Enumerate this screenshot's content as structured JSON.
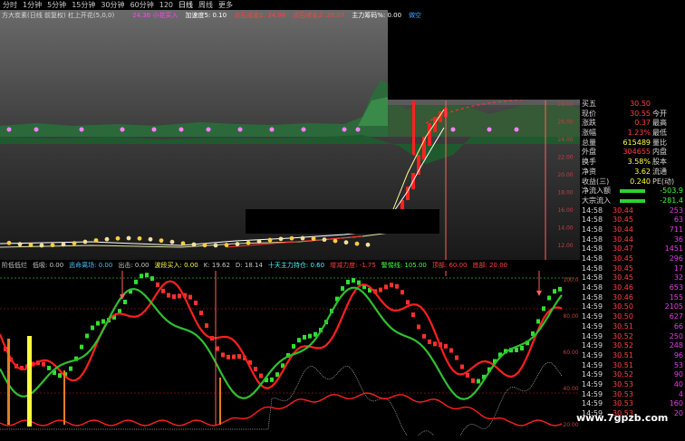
{
  "periods": [
    "分时",
    "1分钟",
    "5分钟",
    "15分钟",
    "30分钟",
    "60分钟",
    "120",
    "日线",
    "周线",
    "更多"
  ],
  "active_period": "日线",
  "chart_title": "方大炭素(日线 前复权) 杠上开花(5,0,0)",
  "main_indicators": [
    {
      "label": "24.36 小花买入",
      "color": "#ff40ff"
    },
    {
      "label": "加速度5: 0.10",
      "color": "#ffffff"
    },
    {
      "label": "点石成金1: 34.96",
      "color": "#ff4040"
    },
    {
      "label": "点石成金2: 20.07",
      "color": "#ff4040"
    },
    {
      "label": "主力筹码%: 0.00",
      "color": "#ffffff"
    },
    {
      "label": "做空",
      "color": "#40a0ff"
    }
  ],
  "price_axis": [
    "28.00",
    "26.00",
    "24.00",
    "22.00",
    "20.00",
    "18.00",
    "16.00",
    "14.00",
    "12.00",
    "10.00"
  ],
  "indicator_header": [
    {
      "label": "阶低低烂",
      "color": "#c8c8c8"
    },
    {
      "label": "低吸: 0.00",
      "color": "#c8c8c8"
    },
    {
      "label": "逃命离场: 0.00",
      "color": "#40c0ff"
    },
    {
      "label": "出击: 0.00",
      "color": "#c8c8c8"
    },
    {
      "label": "波段买入: 0.00",
      "color": "#ffff40"
    },
    {
      "label": "K: 19.62",
      "color": "#c8c8c8"
    },
    {
      "label": "D: 18.14",
      "color": "#c8c8c8"
    },
    {
      "label": "十天主力持仓: 0.60",
      "color": "#40ffff"
    },
    {
      "label": "增减力度: -1.75",
      "color": "#ff4040"
    },
    {
      "label": "警惕线: 105.00",
      "color": "#40ff40"
    },
    {
      "label": "顶部: 60.00",
      "color": "#ff4040"
    },
    {
      "label": "底部: 20.00",
      "color": "#ff4040"
    }
  ],
  "indicator_axis": [
    "100.0",
    "80.00",
    "60.00",
    "40.00",
    "20.00"
  ],
  "quote": {
    "rows": [
      {
        "label": "买五",
        "value": "30.50",
        "color": "red"
      },
      {
        "label": "现价",
        "value": "30.55",
        "color": "red",
        "label2": "今开"
      },
      {
        "label": "涨跌",
        "value": "0.37",
        "color": "red",
        "label2": "最高"
      },
      {
        "label": "涨幅",
        "value": "1.23%",
        "color": "red",
        "label2": "最低"
      },
      {
        "label": "总量",
        "value": "615489",
        "color": "yel",
        "label2": "量比"
      },
      {
        "label": "外盘",
        "value": "304655",
        "color": "red",
        "label2": "内盘"
      },
      {
        "label": "换手",
        "value": "3.58%",
        "color": "yel",
        "label2": "股本"
      },
      {
        "label": "净资",
        "value": "3.62",
        "color": "yel",
        "label2": "流通"
      },
      {
        "label": "收益(三)",
        "value": "0.240",
        "color": "yel",
        "label2": "PE(动)"
      },
      {
        "label": "净流入额",
        "value": "-503.9",
        "color": "grn"
      },
      {
        "label": "大宗流入",
        "value": "-281.4",
        "color": "grn"
      }
    ],
    "ticks": [
      {
        "time": "14:58",
        "price": "30.44",
        "vol": "253"
      },
      {
        "time": "14:58",
        "price": "30.45",
        "vol": "63"
      },
      {
        "time": "14:58",
        "price": "30.44",
        "vol": "711"
      },
      {
        "time": "14:58",
        "price": "30.44",
        "vol": "36"
      },
      {
        "time": "14:58",
        "price": "30.47",
        "vol": "1451"
      },
      {
        "time": "14:58",
        "price": "30.45",
        "vol": "296"
      },
      {
        "time": "14:58",
        "price": "30.45",
        "vol": "17"
      },
      {
        "time": "14:58",
        "price": "30.45",
        "vol": "32"
      },
      {
        "time": "14:58",
        "price": "30.46",
        "vol": "653"
      },
      {
        "time": "14:58",
        "price": "30.46",
        "vol": "155"
      },
      {
        "time": "14:59",
        "price": "30.50",
        "vol": "2105"
      },
      {
        "time": "14:59",
        "price": "30.50",
        "vol": "627"
      },
      {
        "time": "14:59",
        "price": "30.51",
        "vol": "66"
      },
      {
        "time": "14:59",
        "price": "30.52",
        "vol": "250"
      },
      {
        "time": "14:59",
        "price": "30.52",
        "vol": "248"
      },
      {
        "time": "14:59",
        "price": "30.51",
        "vol": "96"
      },
      {
        "time": "14:59",
        "price": "30.51",
        "vol": "53"
      },
      {
        "time": "14:59",
        "price": "30.52",
        "vol": "90"
      },
      {
        "time": "14:59",
        "price": "30.53",
        "vol": "40"
      },
      {
        "time": "14:59",
        "price": "30.53",
        "vol": "4"
      },
      {
        "time": "14:59",
        "price": "30.53",
        "vol": "160"
      },
      {
        "time": "14:59",
        "price": "30.53",
        "vol": "20"
      }
    ]
  },
  "watermark": "www.7gpzb.com",
  "colors": {
    "up": "#ff3030",
    "down": "#30d030",
    "overlay_gray": "#404040"
  }
}
